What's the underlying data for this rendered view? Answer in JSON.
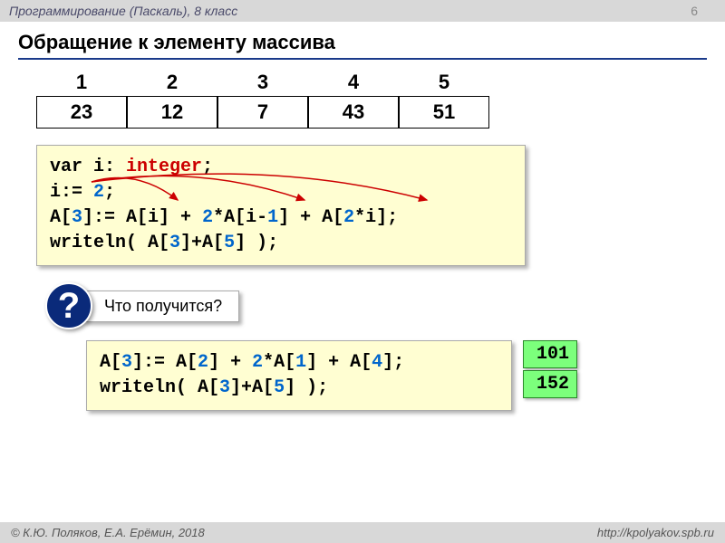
{
  "header": {
    "subject": "Программирование (Паскаль), 8 класс",
    "page": "6"
  },
  "title": "Обращение к элементу массива",
  "indices": [
    "1",
    "2",
    "3",
    "4",
    "5"
  ],
  "array": [
    "23",
    "12",
    "7",
    "43",
    "51"
  ],
  "code1": {
    "l1a": "var i: ",
    "l1b": "integer",
    "l1c": ";",
    "l2a": "i:= ",
    "l2b": "2",
    "l2c": ";",
    "l3a": "A[",
    "l3b": "3",
    "l3c": "]:= A[i] + ",
    "l3d": "2",
    "l3e": "*A[i-",
    "l3f": "1",
    "l3g": "] + A[",
    "l3h": "2",
    "l3i": "*i];",
    "l4a": "writeln( A[",
    "l4b": "3",
    "l4c": "]+A[",
    "l4d": "5",
    "l4e": "] );"
  },
  "question": {
    "mark": "?",
    "text": "Что получится?"
  },
  "code2": {
    "l1a": "A[",
    "l1b": "3",
    "l1c": "]:= A[",
    "l1d": "2",
    "l1e": "] + ",
    "l1f": "2",
    "l1g": "*A[",
    "l1h": "1",
    "l1i": "] + A[",
    "l1j": "4",
    "l1k": "];",
    "l2a": "writeln( A[",
    "l2b": "3",
    "l2c": "]+A[",
    "l2d": "5",
    "l2e": "] );"
  },
  "results": [
    "101",
    "152"
  ],
  "footer": {
    "left": "© К.Ю. Поляков, Е.А. Ерёмин, 2018",
    "right": "http://kpolyakov.spb.ru"
  }
}
